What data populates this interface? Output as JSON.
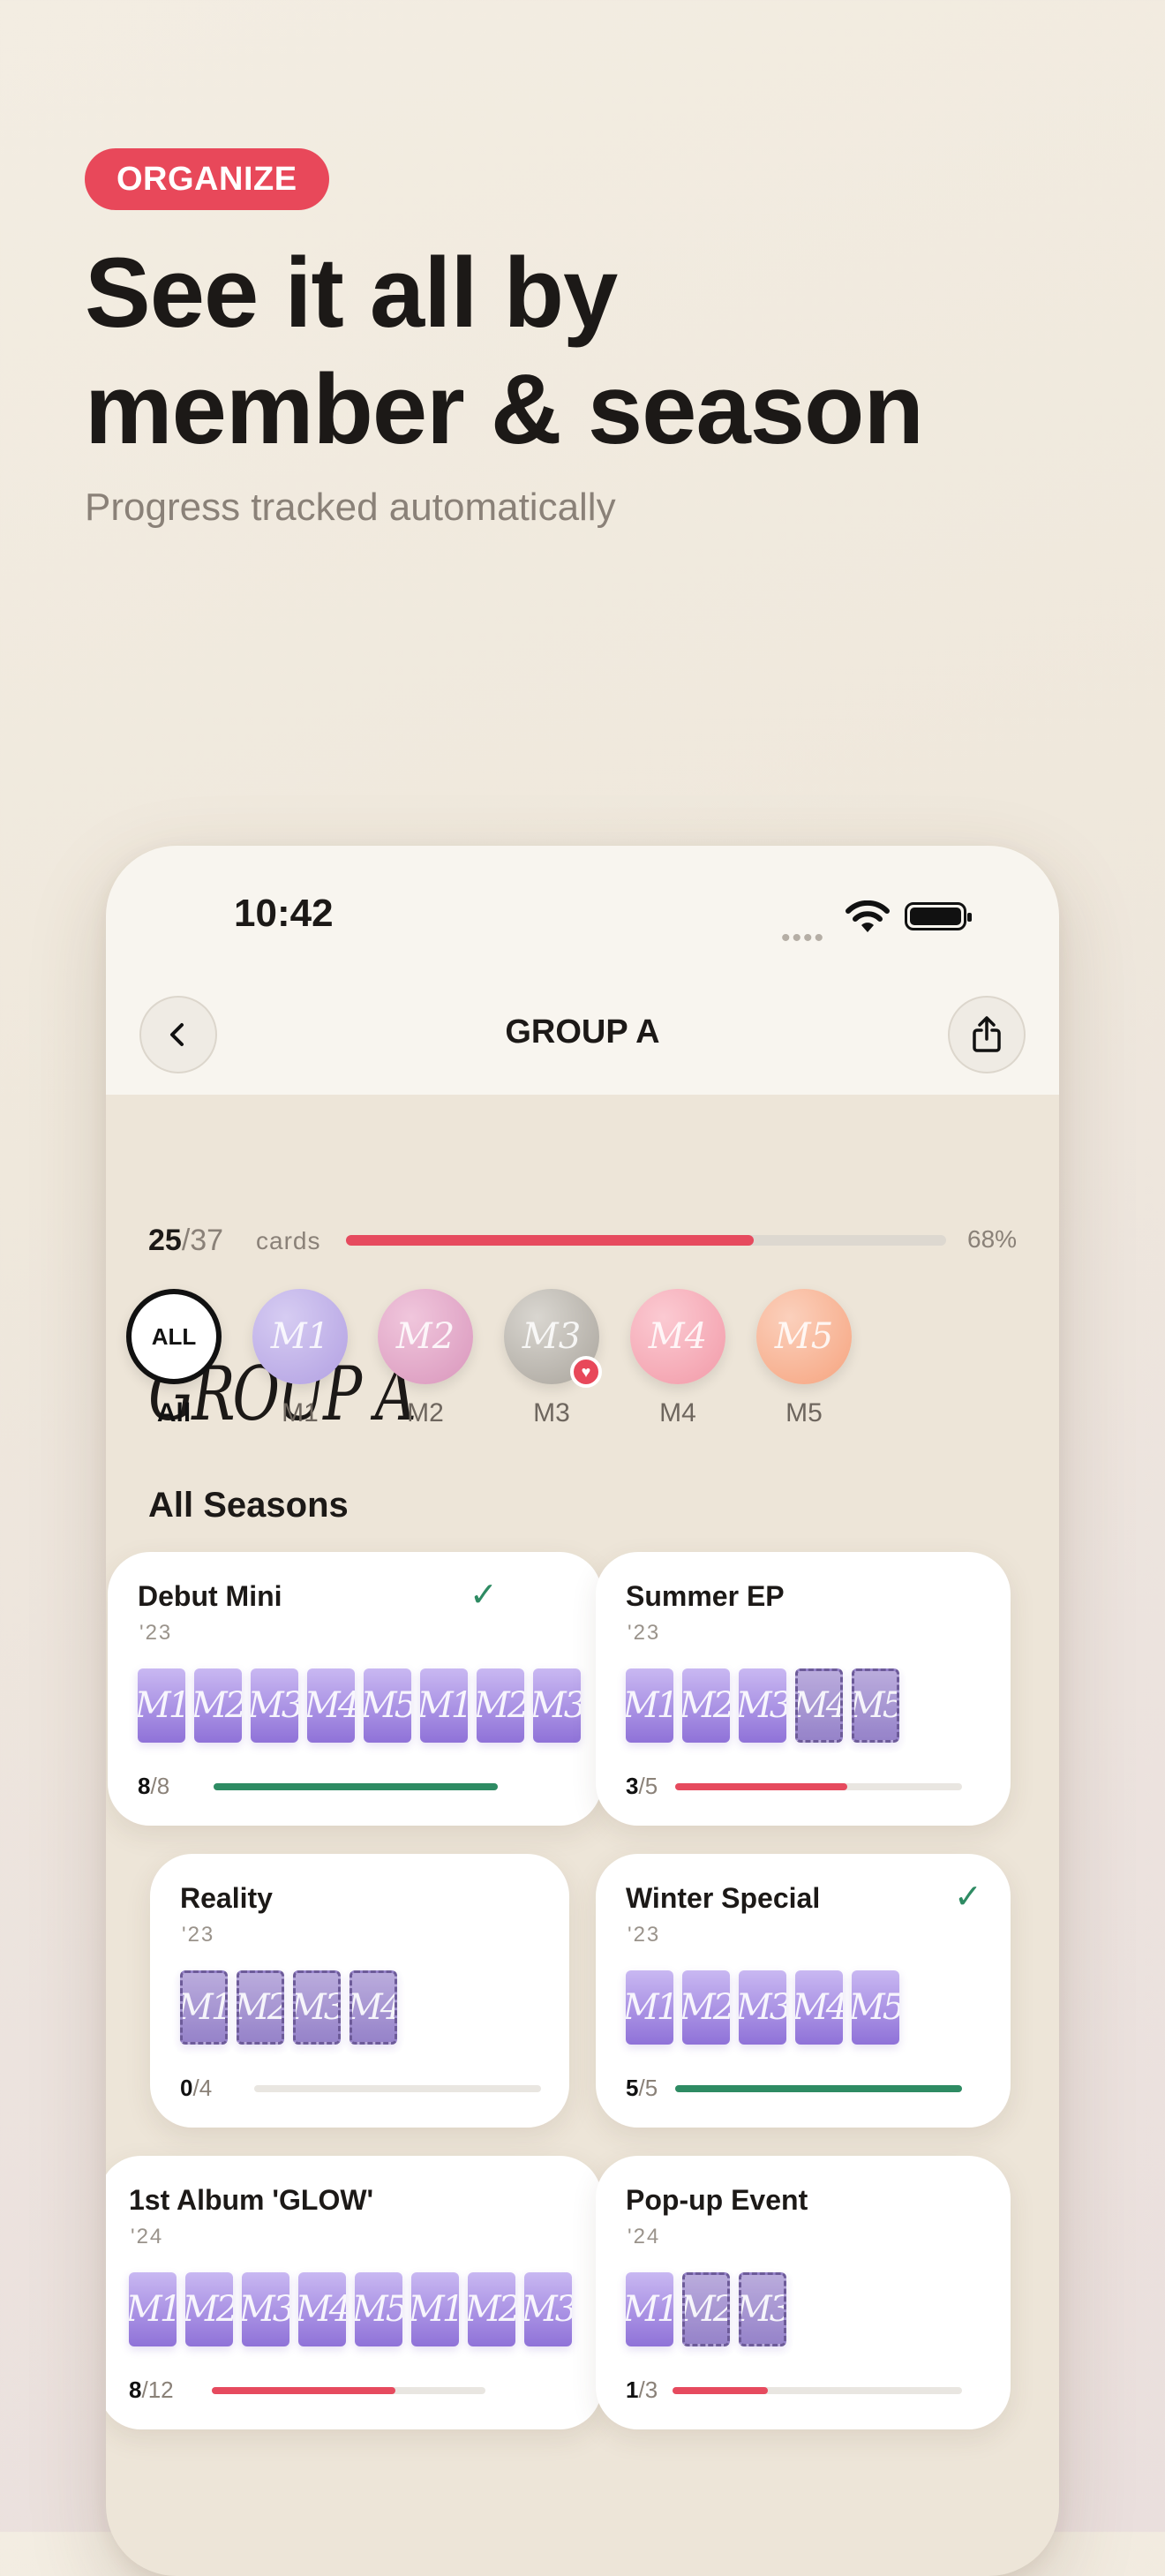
{
  "hero": {
    "badge": "ORGANIZE",
    "title_line1": "See it all by",
    "title_line2": "member & season",
    "subtitle": "Progress tracked automatically"
  },
  "status_bar": {
    "time": "10:42",
    "dots": "••••"
  },
  "nav": {
    "title": "GROUP A",
    "back_icon": "chevron-left-icon",
    "share_icon": "share-icon"
  },
  "group": {
    "title": "GROUP A",
    "collected": "25",
    "total": "/37",
    "unit": "cards",
    "progress": 0.68,
    "percent": "68%"
  },
  "members": [
    {
      "circle": "ALL",
      "name": "All",
      "active": true
    },
    {
      "circle": "M1",
      "name": "M1",
      "color_a": "#d6ccf2",
      "color_b": "#b2a0e2"
    },
    {
      "circle": "M2",
      "name": "M2",
      "color_a": "#f0c6dc",
      "color_b": "#d996bc"
    },
    {
      "circle": "M3",
      "name": "M3",
      "color_a": "#d9d6d0",
      "color_b": "#a9a49c",
      "favorite": true
    },
    {
      "circle": "M4",
      "name": "M4",
      "color_a": "#fbcad2",
      "color_b": "#f29aa8"
    },
    {
      "circle": "M5",
      "name": "M5",
      "color_a": "#fbd0bc",
      "color_b": "#f6a47f"
    }
  ],
  "section_title": "All Seasons",
  "colors": {
    "accent": "#e64a5e",
    "complete": "#2e8b63"
  },
  "seasons": [
    {
      "title": "Debut Mini",
      "year": "'23",
      "count": "8",
      "total": "/8",
      "progress": 1.0,
      "complete": true,
      "slots": [
        [
          "M1",
          1
        ],
        [
          "M2",
          1
        ],
        [
          "M3",
          1
        ],
        [
          "M4",
          1
        ],
        [
          "M5",
          1
        ],
        [
          "M1",
          1
        ],
        [
          "M2",
          1
        ],
        [
          "M3",
          1
        ]
      ]
    },
    {
      "title": "Summer EP",
      "year": "'23",
      "count": "3",
      "total": "/5",
      "progress": 0.6,
      "complete": false,
      "slots": [
        [
          "M1",
          1
        ],
        [
          "M2",
          1
        ],
        [
          "M3",
          1
        ],
        [
          "M4",
          0
        ],
        [
          "M5",
          0
        ]
      ]
    },
    {
      "title": "Reality",
      "year": "'23",
      "count": "0",
      "total": "/4",
      "progress": 0,
      "complete": false,
      "slots": [
        [
          "M1",
          0
        ],
        [
          "M2",
          0
        ],
        [
          "M3",
          0
        ],
        [
          "M4",
          0
        ]
      ]
    },
    {
      "title": "Winter Special",
      "year": "'23",
      "count": "5",
      "total": "/5",
      "progress": 1.0,
      "complete": true,
      "slots": [
        [
          "M1",
          1
        ],
        [
          "M2",
          1
        ],
        [
          "M3",
          1
        ],
        [
          "M4",
          1
        ],
        [
          "M5",
          1
        ]
      ]
    },
    {
      "title": "1st Album 'GLOW'",
      "year": "'24",
      "count": "8",
      "total": "/12",
      "progress": 0.67,
      "complete": false,
      "slots": [
        [
          "M1",
          1
        ],
        [
          "M2",
          1
        ],
        [
          "M3",
          1
        ],
        [
          "M4",
          1
        ],
        [
          "M5",
          1
        ],
        [
          "M1",
          1
        ],
        [
          "M2",
          1
        ],
        [
          "M3",
          1
        ]
      ]
    },
    {
      "title": "Pop-up Event",
      "year": "'24",
      "count": "1",
      "total": "/3",
      "progress": 0.33,
      "complete": false,
      "slots": [
        [
          "M1",
          1
        ],
        [
          "M2",
          0
        ],
        [
          "M3",
          0
        ]
      ]
    }
  ]
}
